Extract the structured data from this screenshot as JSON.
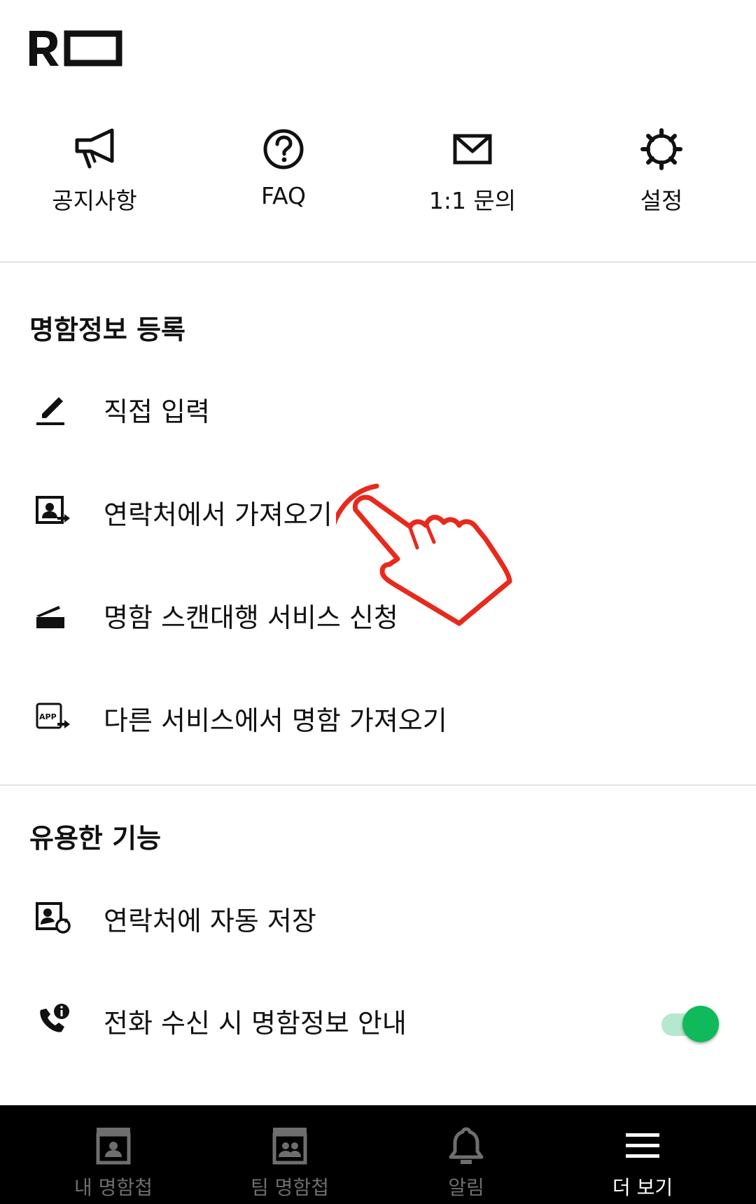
{
  "app": {
    "logo_icon": "remember-logo"
  },
  "quick_links": [
    {
      "label": "공지사항",
      "icon": "megaphone-icon"
    },
    {
      "label": "FAQ",
      "icon": "question-circle-icon"
    },
    {
      "label": "1:1 문의",
      "icon": "envelope-icon"
    },
    {
      "label": "설정",
      "icon": "gear-icon"
    }
  ],
  "sections": {
    "register": {
      "title": "명함정보 등록",
      "items": [
        {
          "label": "직접 입력",
          "icon": "pencil-icon"
        },
        {
          "label": "연락처에서 가져오기",
          "icon": "contact-import-icon"
        },
        {
          "label": "명함 스캔대행 서비스 신청",
          "icon": "scanner-icon"
        },
        {
          "label": "다른 서비스에서 명함 가져오기",
          "icon": "app-import-icon"
        }
      ]
    },
    "features": {
      "title": "유용한 기능",
      "items": [
        {
          "label": "연락처에 자동 저장",
          "icon": "contact-sync-icon"
        },
        {
          "label": "전화 수신 시 명함정보 안내",
          "icon": "phone-info-icon",
          "toggle_on": true
        }
      ]
    }
  },
  "overlay": {
    "icon": "pointing-hand-icon"
  },
  "colors": {
    "toggle_on": "#0fba5a",
    "toggle_track": "#b6e8cd",
    "nav_bg": "#000000",
    "nav_inactive": "#6e6e6e",
    "annotation_red": "#e8291c"
  },
  "bottom_nav": [
    {
      "label": "내 명함첩",
      "icon": "my-cards-icon",
      "active": false
    },
    {
      "label": "팀 명함첩",
      "icon": "team-cards-icon",
      "active": false
    },
    {
      "label": "알림",
      "icon": "bell-icon",
      "active": false
    },
    {
      "label": "더 보기",
      "icon": "menu-icon",
      "active": true
    }
  ]
}
